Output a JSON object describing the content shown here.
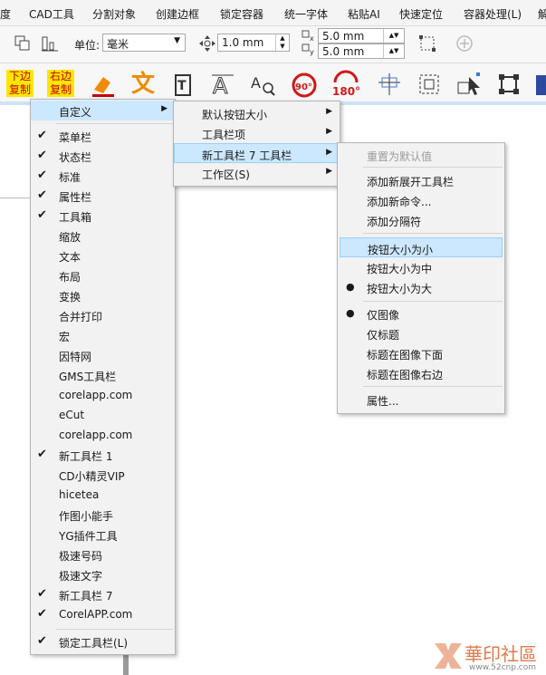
{
  "menubar": {
    "items": [
      "度",
      "CAD工具",
      "分割对象",
      "创建边框",
      "锁定容器",
      "统一字体",
      "粘贴AI",
      "快速定位",
      "容器处理(L)",
      "解"
    ]
  },
  "propbar": {
    "unit_label": "单位:",
    "unit_value": "毫米",
    "nudge_value": "1.0 mm",
    "dup_x": "5.0 mm",
    "dup_y": "5.0 mm"
  },
  "toolbar": {
    "btn1_line1": "下边",
    "btn1_line2": "复制",
    "btn2_line1": "右边",
    "btn2_line2": "复制",
    "text_icon_char": "文",
    "rotate90": "90°",
    "rotate180": "180°",
    "colors": {
      "yellow": "#ffe600",
      "red": "#c40000",
      "orange": "#f08a00"
    }
  },
  "menu_main": {
    "header": "自定义",
    "items": [
      {
        "label": "菜单栏",
        "checked": true
      },
      {
        "label": "状态栏",
        "checked": true
      },
      {
        "label": "标准",
        "checked": true
      },
      {
        "label": "属性栏",
        "checked": true
      },
      {
        "label": "工具箱",
        "checked": true
      },
      {
        "label": "缩放",
        "checked": false
      },
      {
        "label": "文本",
        "checked": false
      },
      {
        "label": "布局",
        "checked": false
      },
      {
        "label": "变换",
        "checked": false
      },
      {
        "label": "合并打印",
        "checked": false
      },
      {
        "label": "宏",
        "checked": false
      },
      {
        "label": "因特网",
        "checked": false
      },
      {
        "label": "GMS工具栏",
        "checked": false
      },
      {
        "label": "corelapp.com",
        "checked": false
      },
      {
        "label": "eCut",
        "checked": false
      },
      {
        "label": "corelapp.com",
        "checked": false
      },
      {
        "label": "新工具栏 1",
        "checked": true
      },
      {
        "label": "CD小精灵VIP",
        "checked": false
      },
      {
        "label": "hicetea",
        "checked": false
      },
      {
        "label": "作图小能手",
        "checked": false
      },
      {
        "label": "YG插件工具",
        "checked": false
      },
      {
        "label": "极速号码",
        "checked": false
      },
      {
        "label": "极速文字",
        "checked": false
      },
      {
        "label": "新工具栏 7",
        "checked": true
      },
      {
        "label": "CorelAPP.com",
        "checked": true
      }
    ],
    "footer": {
      "label": "锁定工具栏(L)",
      "checked": true
    }
  },
  "menu_custom": {
    "items": [
      "默认按钮大小",
      "工具栏项",
      "新工具栏 7 工具栏",
      "工作区(S)"
    ]
  },
  "menu_toolbar7": {
    "reset": "重置为默认值",
    "group1": [
      "添加新展开工具栏",
      "添加新命令...",
      "添加分隔符"
    ],
    "group2": [
      {
        "label": "按钮大小为小",
        "bullet": false
      },
      {
        "label": "按钮大小为中",
        "bullet": false
      },
      {
        "label": "按钮大小为大",
        "bullet": true
      }
    ],
    "group3": [
      {
        "label": "仅图像",
        "bullet": true
      },
      {
        "label": "仅标题",
        "bullet": false
      },
      {
        "label": "标题在图像下面",
        "bullet": false
      },
      {
        "label": "标题在图像右边",
        "bullet": false
      }
    ],
    "properties": "属性..."
  },
  "watermark": {
    "name": "華印社區",
    "url": "www.52cnp.com"
  },
  "symbols": {
    "check": "✔",
    "bullet": "●",
    "submenu": "▶"
  }
}
